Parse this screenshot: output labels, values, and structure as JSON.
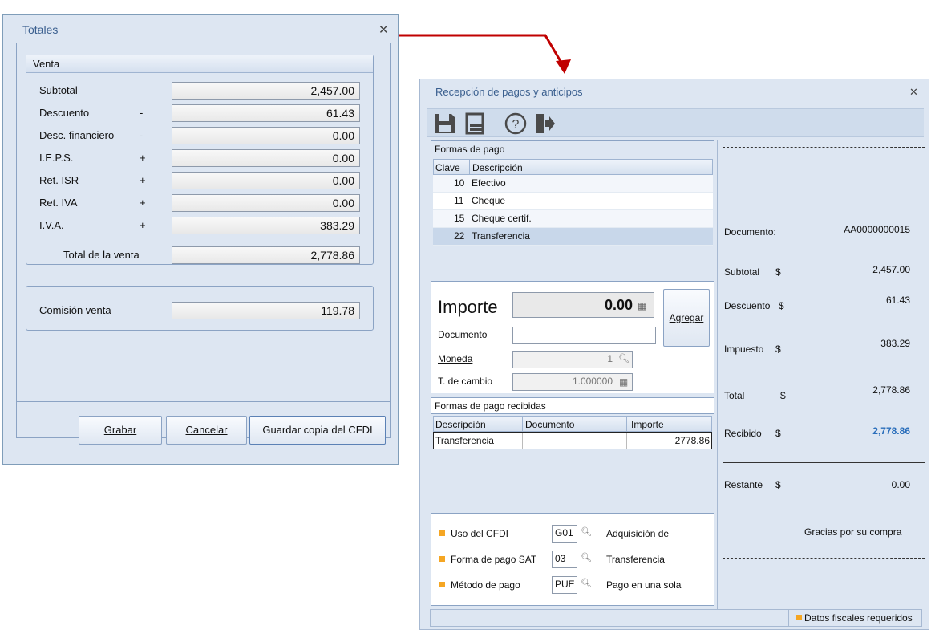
{
  "totales": {
    "title": "Totales",
    "group_venta": "Venta",
    "rows": [
      {
        "label": "Subtotal",
        "sign": "",
        "value": "2,457.00"
      },
      {
        "label": "Descuento",
        "sign": "-",
        "value": "61.43"
      },
      {
        "label": "Desc. financiero",
        "sign": "-",
        "value": "0.00"
      },
      {
        "label": "I.E.P.S.",
        "sign": "+",
        "value": "0.00"
      },
      {
        "label": "Ret. ISR",
        "sign": "+",
        "value": "0.00"
      },
      {
        "label": "Ret. IVA",
        "sign": "+",
        "value": "0.00"
      },
      {
        "label": "I.V.A.",
        "sign": "+",
        "value": "383.29"
      }
    ],
    "total_label": "Total de la venta",
    "total_value": "2,778.86",
    "comision_label": "Comisión venta",
    "comision_value": "119.78",
    "buttons": {
      "grabar": "Grabar",
      "cancelar": "Cancelar",
      "guardar": "Guardar copia del CFDI"
    }
  },
  "recepcion": {
    "title": "Recepción de pagos y anticipos",
    "formas_pago": {
      "heading": "Formas de pago",
      "columns": [
        "Clave",
        "Descripción"
      ],
      "rows": [
        {
          "clave": "10",
          "descripcion": "Efectivo"
        },
        {
          "clave": "11",
          "descripcion": "Cheque"
        },
        {
          "clave": "15",
          "descripcion": "Cheque certif."
        },
        {
          "clave": "22",
          "descripcion": "Transferencia"
        }
      ]
    },
    "importe_label": "Importe",
    "importe_value": "0.00",
    "agregar_label": "Agregar",
    "documento_label": "Documento",
    "documento_value": "",
    "moneda_label": "Moneda",
    "moneda_value": "1",
    "tipo_cambio_label": "T. de cambio",
    "tipo_cambio_value": "1.000000",
    "recibidas": {
      "heading": "Formas de pago recibidas",
      "columns": [
        "Descripción",
        "Documento",
        "Importe"
      ],
      "rows": [
        {
          "descripcion": "Transferencia",
          "documento": "",
          "importe": "2778.86"
        }
      ]
    },
    "fiscal": [
      {
        "label": "Uso del CFDI",
        "code": "G01",
        "desc": "Adquisición de"
      },
      {
        "label": "Forma de pago SAT",
        "code": "03",
        "desc": "Transferencia"
      },
      {
        "label": "Método de pago",
        "code": "PUE",
        "desc": "Pago en una sola"
      }
    ],
    "receipt": {
      "documento_label": "Documento:",
      "documento_value": "AA0000000015",
      "subtotal_label": "Subtotal",
      "subtotal_value": "2,457.00",
      "descuento_label": "Descuento",
      "descuento_value": "61.43",
      "impuesto_label": "Impuesto",
      "impuesto_value": "383.29",
      "total_label": "Total",
      "total_value": "2,778.86",
      "recibido_label": "Recibido",
      "recibido_value": "2,778.86",
      "restante_label": "Restante",
      "restante_value": "0.00",
      "currency": "$",
      "gracias": "Gracias por su compra"
    },
    "status": "Datos fiscales requeridos"
  },
  "colors": {
    "accent_blue": "#2a6ebb",
    "arrow_red": "#c00000",
    "required_orange": "#f5a623"
  }
}
